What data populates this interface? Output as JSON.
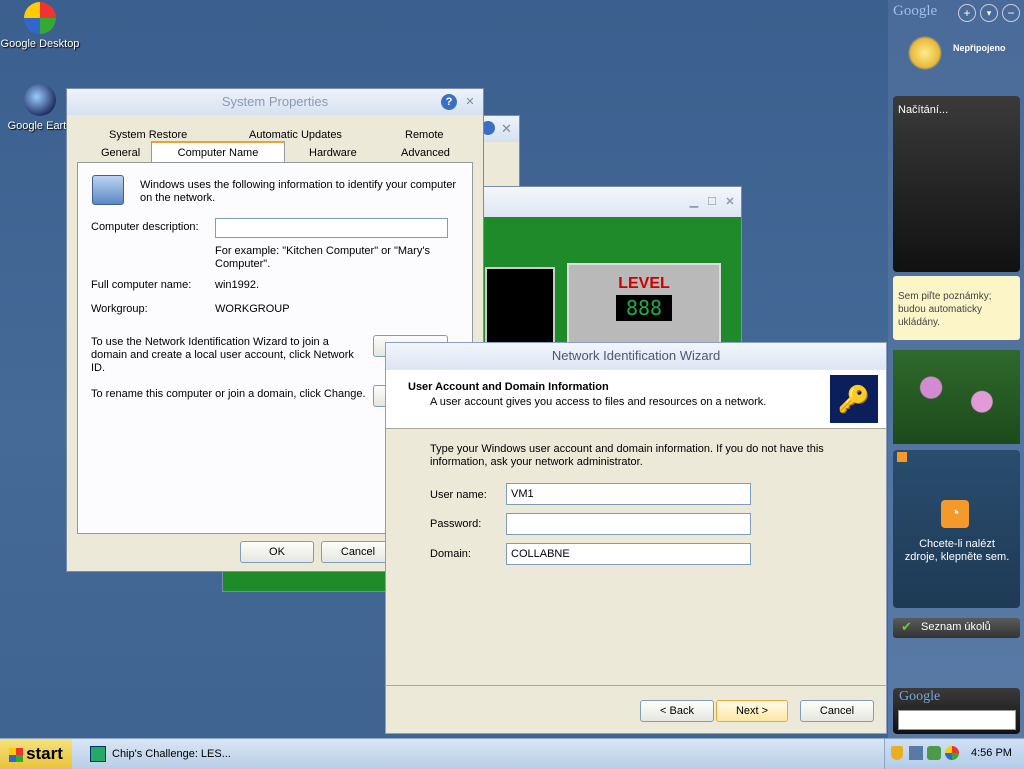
{
  "desktop": {
    "icons": [
      {
        "label": "Google Desktop",
        "icon": "google-desktop-icon"
      },
      {
        "label": "Google Earth",
        "icon": "google-earth-icon"
      }
    ]
  },
  "system_properties": {
    "title": "System Properties",
    "tabs_row1": [
      "System Restore",
      "Automatic Updates",
      "Remote"
    ],
    "tabs_row2": [
      "General",
      "Computer Name",
      "Hardware",
      "Advanced"
    ],
    "active_tab": "Computer Name",
    "intro": "Windows uses the following information to identify your computer on the network.",
    "description_label": "Computer description:",
    "description_value": "",
    "example": "For example: \"Kitchen Computer\" or \"Mary's Computer\".",
    "full_name_label": "Full computer name:",
    "full_name_value": "win1992.",
    "workgroup_label": "Workgroup:",
    "workgroup_value": "WORKGROUP",
    "network_id_text": "To use the Network Identification Wizard to join a domain and create a local user account, click Network ID.",
    "rename_text": "To rename this computer or join a domain, click Change.",
    "ok": "OK",
    "cancel": "Cancel"
  },
  "chips_challenge": {
    "level_label": "LEVEL",
    "level_digits": "888"
  },
  "wizard": {
    "title": "Network Identification Wizard",
    "header_title": "User Account and Domain Information",
    "header_subtitle": "A user account gives you access to files and resources on a network.",
    "body_text": "Type your Windows user account and domain information. If you do not have this information, ask your network administrator.",
    "username_label": "User name:",
    "username_value": "VM1",
    "password_label": "Password:",
    "password_value": "",
    "domain_label": "Domain:",
    "domain_value": "COLLABNE",
    "back": "< Back",
    "next": "Next >",
    "cancel": "Cancel"
  },
  "sidebar": {
    "brand": "Google",
    "status": "Nepřipojeno",
    "loading": "Načítání...",
    "notes": "Sem piľte poznámky; budou automaticky ukládány.",
    "feeds": "Chcete-li nalézt zdroje, klepněte sem.",
    "tasks": "Seznam úkolů",
    "search_brand": "Google"
  },
  "taskbar": {
    "start": "start",
    "task": "Chip's Challenge: LES...",
    "clock": "4:56 PM"
  },
  "colors": {
    "desktop": "#3b5f8e",
    "start": "#e8c23c",
    "wizard_header": "#ffffff"
  }
}
